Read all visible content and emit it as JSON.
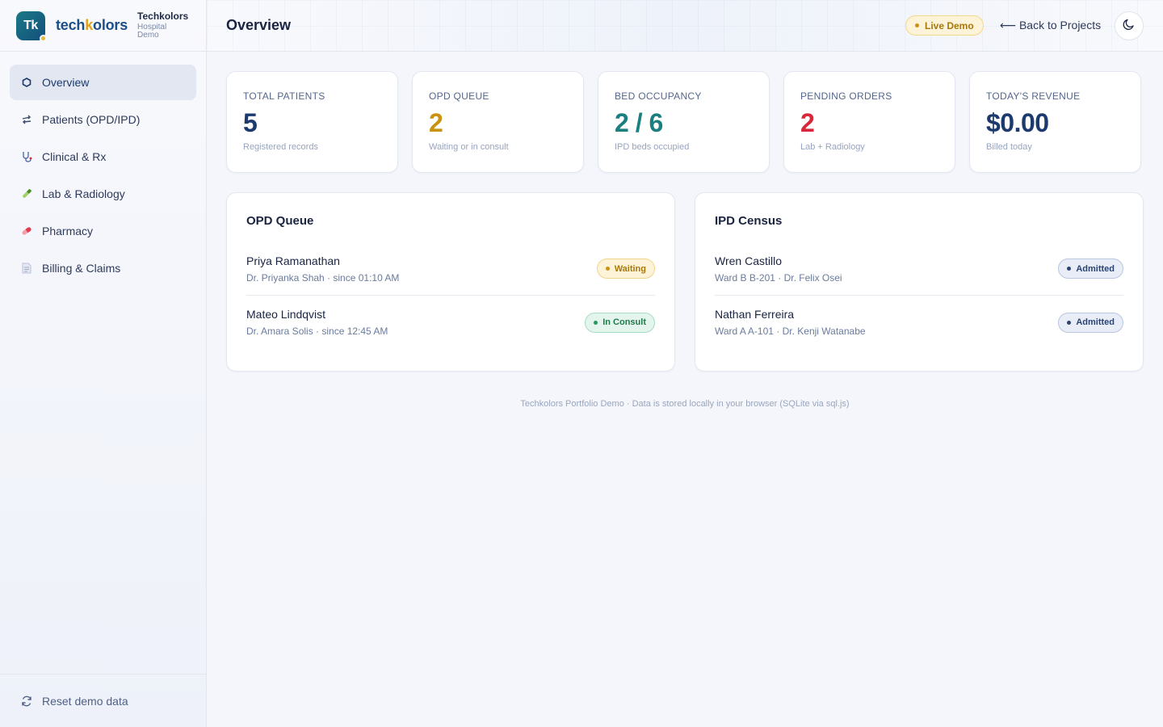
{
  "brand": {
    "logo_text": "Tk",
    "wordmark_a": "tech",
    "wordmark_b": "k",
    "wordmark_c": "olors",
    "title": "Techkolors",
    "subtitle": "Hospital Demo"
  },
  "sidebar": {
    "items": [
      {
        "label": "Overview",
        "icon": "hexagon-icon",
        "active": true
      },
      {
        "label": "Patients (OPD/IPD)",
        "icon": "transfer-arrows-icon"
      },
      {
        "label": "Clinical & Rx",
        "icon": "stethoscope-icon"
      },
      {
        "label": "Lab & Radiology",
        "icon": "test-tube-icon"
      },
      {
        "label": "Pharmacy",
        "icon": "pill-icon"
      },
      {
        "label": "Billing & Claims",
        "icon": "document-icon"
      }
    ],
    "reset_label": "Reset demo data"
  },
  "header": {
    "title": "Overview",
    "live_badge": "Live Demo",
    "back_link": "⟵ Back to Projects",
    "theme_icon": "moon-icon"
  },
  "stats": [
    {
      "label": "Total Patients",
      "value": "5",
      "sub": "Registered records",
      "color": "#1c3a6e"
    },
    {
      "label": "OPD Queue",
      "value": "2",
      "sub": "Waiting or in consult",
      "color": "#c9920f"
    },
    {
      "label": "Bed Occupancy",
      "value": "2 / 6",
      "sub": "IPD beds occupied",
      "color": "#1b7f80"
    },
    {
      "label": "Pending Orders",
      "value": "2",
      "sub": "Lab + Radiology",
      "color": "#d6283a"
    },
    {
      "label": "Today's Revenue",
      "value": "$0.00",
      "sub": "Billed today",
      "color": "#1c3a6e"
    }
  ],
  "opd": {
    "title": "OPD Queue",
    "rows": [
      {
        "name": "Priya Ramanathan",
        "meta": "Dr. Priyanka Shah · since 01:10 AM",
        "status": "Waiting"
      },
      {
        "name": "Mateo Lindqvist",
        "meta": "Dr. Amara Solis · since 12:45 AM",
        "status": "In Consult"
      }
    ]
  },
  "ipd": {
    "title": "IPD Census",
    "rows": [
      {
        "name": "Wren Castillo",
        "meta": "Ward B B-201 · Dr. Felix Osei",
        "status": "Admitted"
      },
      {
        "name": "Nathan Ferreira",
        "meta": "Ward A A-101 · Dr. Kenji Watanabe",
        "status": "Admitted"
      }
    ]
  },
  "footer": "Techkolors Portfolio Demo · Data is stored locally in your browser (SQLite via sql.js)"
}
